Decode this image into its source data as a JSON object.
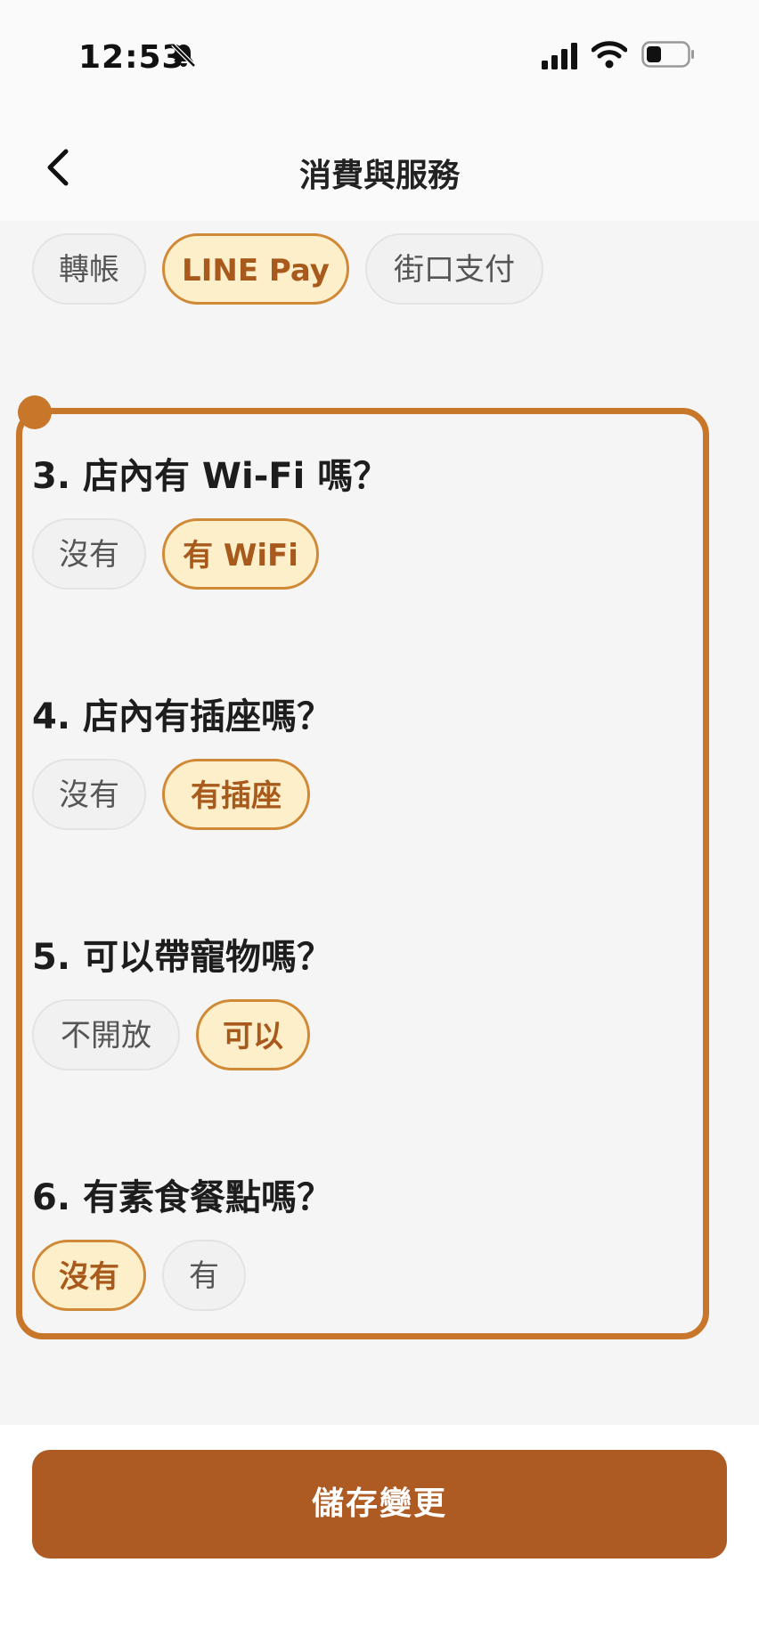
{
  "status_bar": {
    "time": "12:53",
    "icons": [
      "bell-off-icon",
      "signal-icon",
      "wifi-icon",
      "battery-icon"
    ]
  },
  "header": {
    "title": "消費與服務",
    "back_icon": "chevron-left-icon"
  },
  "payment_options": {
    "items": [
      {
        "label": "轉帳",
        "selected": false
      },
      {
        "label": "LINE Pay",
        "selected": true
      },
      {
        "label": "街口支付",
        "selected": false
      }
    ]
  },
  "questions": [
    {
      "title": "3. 店內有 Wi-Fi 嗎？",
      "options": [
        {
          "label": "沒有",
          "selected": false
        },
        {
          "label": "有 WiFi",
          "selected": true
        }
      ]
    },
    {
      "title": "4. 店內有插座嗎？",
      "options": [
        {
          "label": "沒有",
          "selected": false
        },
        {
          "label": "有插座",
          "selected": true
        }
      ]
    },
    {
      "title": "5. 可以帶寵物嗎？",
      "options": [
        {
          "label": "不開放",
          "selected": false
        },
        {
          "label": "可以",
          "selected": true
        }
      ]
    },
    {
      "title": "6. 有素食餐點嗎？",
      "options": [
        {
          "label": "沒有",
          "selected": true
        },
        {
          "label": "有",
          "selected": false
        }
      ]
    }
  ],
  "footer": {
    "save_label": "儲存變更"
  },
  "colors": {
    "accent": "#c8762a",
    "selected_bg": "#fdefc9",
    "selected_text": "#a85a1c",
    "save_button": "#ad5a23"
  }
}
